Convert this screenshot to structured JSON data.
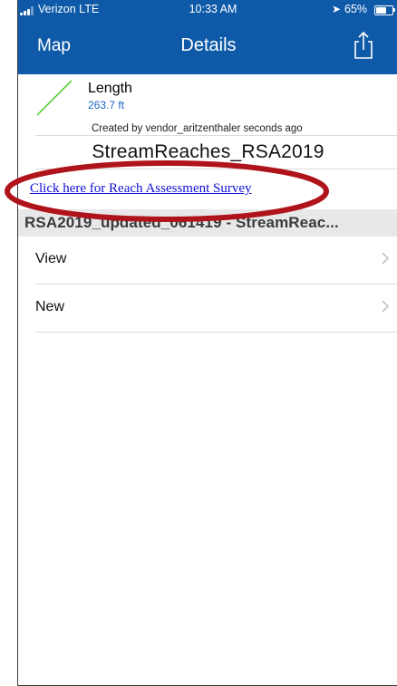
{
  "status_bar": {
    "carrier": "Verizon LTE",
    "time": "10:33 AM",
    "battery_percent_label": "65%",
    "battery_level": 0.65,
    "icons": [
      "signal-bars-icon",
      "location-arrow-icon",
      "battery-icon"
    ]
  },
  "nav": {
    "back_label": "Map",
    "title": "Details",
    "share_icon": "share-icon"
  },
  "feature": {
    "geometry_icon": "line-geometry-icon",
    "field_label": "Length",
    "field_value": "263.7 ft",
    "created_by": "Created by vendor_aritzenthaler seconds ago",
    "layer_title": "StreamReaches_RSA2019"
  },
  "survey_link": {
    "text": "Click here for Reach Assessment Survey"
  },
  "section": {
    "header": "RSA2019_updated_061419 - StreamReac..."
  },
  "rows": [
    {
      "label": "View"
    },
    {
      "label": "New"
    }
  ],
  "colors": {
    "nav_bar": "#0f5aa8",
    "link": "#1010d8",
    "annotation": "#b0141b",
    "geometry_line": "#5ad43a",
    "field_value": "#1a66c2",
    "section_bg": "#e8e8ea"
  }
}
